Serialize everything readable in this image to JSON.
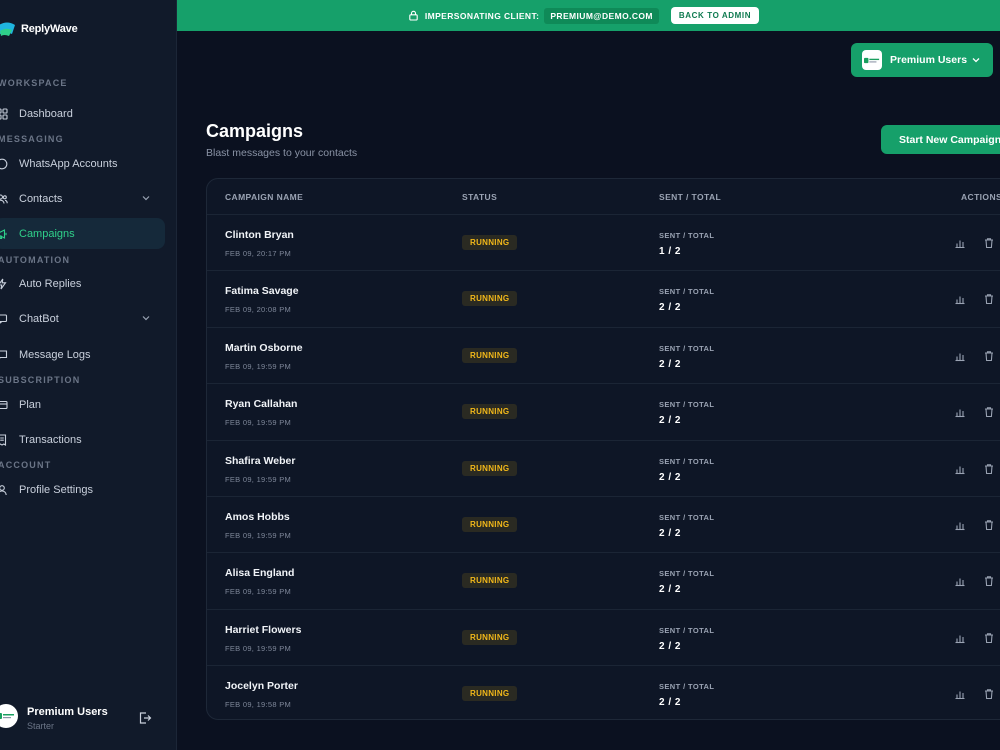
{
  "brand": {
    "name": "ReplyWave"
  },
  "sidebar": {
    "sections": [
      {
        "label": "WORKSPACE"
      },
      {
        "label": "MESSAGING"
      },
      {
        "label": "AUTOMATION"
      },
      {
        "label": "SUBSCRIPTION"
      },
      {
        "label": "ACCOUNT"
      }
    ],
    "items": [
      {
        "label": "Dashboard",
        "icon": "grid-icon"
      },
      {
        "label": "WhatsApp Accounts",
        "icon": "chat-bubble-icon"
      },
      {
        "label": "Contacts",
        "icon": "users-icon"
      },
      {
        "label": "Campaigns",
        "icon": "megaphone-icon",
        "active": true
      },
      {
        "label": "Auto Replies",
        "icon": "bolt-icon"
      },
      {
        "label": "ChatBot",
        "icon": "bot-icon"
      },
      {
        "label": "Message Logs",
        "icon": "message-log-icon"
      },
      {
        "label": "Plan",
        "icon": "card-icon"
      },
      {
        "label": "Transactions",
        "icon": "receipt-icon"
      },
      {
        "label": "Profile Settings",
        "icon": "user-icon"
      }
    ],
    "user": {
      "name": "Premium Users",
      "plan": "Starter"
    }
  },
  "banner": {
    "label": "IMPERSONATING CLIENT:",
    "email": "PREMIUM@DEMO.COM",
    "back_label": "BACK TO ADMIN"
  },
  "org_selector": {
    "name": "Premium Users"
  },
  "page": {
    "title": "Campaigns",
    "subtitle": "Blast messages to your contacts",
    "new_button": "Start New Campaign"
  },
  "table": {
    "headers": {
      "name": "CAMPAIGN NAME",
      "status": "STATUS",
      "sent": "SENT / TOTAL",
      "actions": "ACTIONS"
    },
    "sent_label": "SENT / TOTAL",
    "rows": [
      {
        "name": "Clinton Bryan",
        "date": "FEB 09, 20:17 PM",
        "status": "RUNNING",
        "sent": "1 / 2"
      },
      {
        "name": "Fatima Savage",
        "date": "FEB 09, 20:08 PM",
        "status": "RUNNING",
        "sent": "2 / 2"
      },
      {
        "name": "Martin Osborne",
        "date": "FEB 09, 19:59 PM",
        "status": "RUNNING",
        "sent": "2 / 2"
      },
      {
        "name": "Ryan Callahan",
        "date": "FEB 09, 19:59 PM",
        "status": "RUNNING",
        "sent": "2 / 2"
      },
      {
        "name": "Shafira Weber",
        "date": "FEB 09, 19:59 PM",
        "status": "RUNNING",
        "sent": "2 / 2"
      },
      {
        "name": "Amos Hobbs",
        "date": "FEB 09, 19:59 PM",
        "status": "RUNNING",
        "sent": "2 / 2"
      },
      {
        "name": "Alisa England",
        "date": "FEB 09, 19:59 PM",
        "status": "RUNNING",
        "sent": "2 / 2"
      },
      {
        "name": "Harriet Flowers",
        "date": "FEB 09, 19:59 PM",
        "status": "RUNNING",
        "sent": "2 / 2"
      },
      {
        "name": "Jocelyn Porter",
        "date": "FEB 09, 19:58 PM",
        "status": "RUNNING",
        "sent": "2 / 2"
      }
    ]
  },
  "colors": {
    "accent": "#16a06a",
    "active_text": "#2fd08a",
    "running": "#f2b81a",
    "background": "#0b1120"
  }
}
